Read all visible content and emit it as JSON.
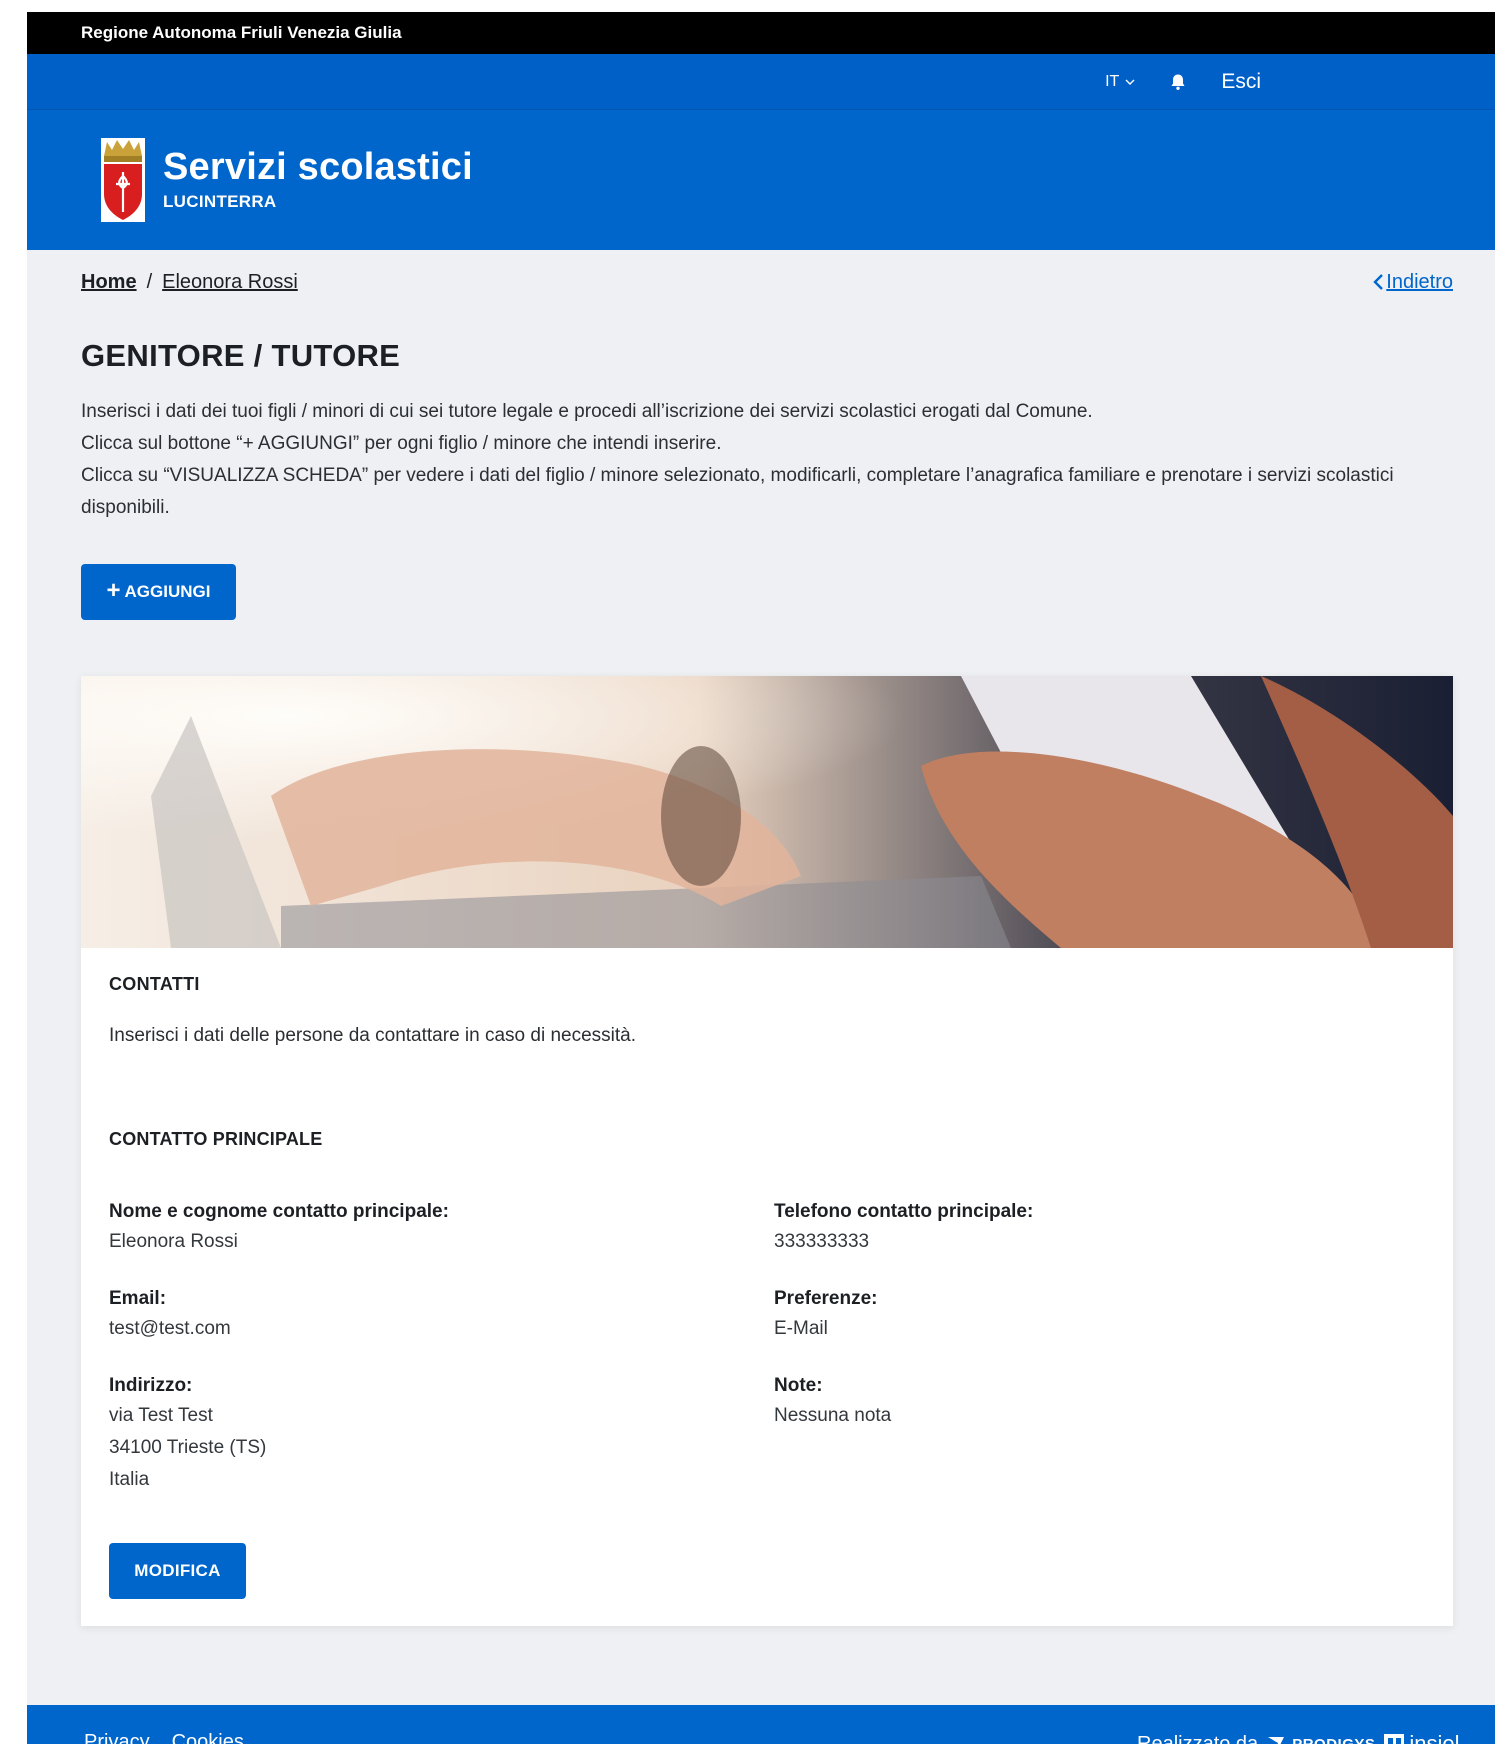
{
  "topbar": {
    "region": "Regione Autonoma Friuli Venezia Giulia"
  },
  "utility": {
    "language": "IT",
    "logout": "Esci"
  },
  "header": {
    "title": "Servizi scolastici",
    "subtitle": "LUCINTERRA"
  },
  "breadcrumb": {
    "home": "Home",
    "current": "Eleonora Rossi",
    "back": "Indietro"
  },
  "page": {
    "title": "GENITORE / TUTORE",
    "intro": [
      "Inserisci i dati dei tuoi figli / minori di cui sei tutore legale e procedi all’iscrizione dei servizi scolastici erogati dal Comune.",
      "Clicca sul bottone “+ AGGIUNGI” per ogni figlio / minore che intendi inserire.",
      "Clicca su “VISUALIZZA SCHEDA” per vedere i dati del figlio / minore selezionato, modificarli, completare l’anagrafica familiare e prenotare i servizi scolastici disponibili."
    ],
    "add_button": "AGGIUNGI"
  },
  "card": {
    "title": "CONTATTI",
    "description": "Inserisci i dati delle persone da contattare in caso di necessità.",
    "section_title": "CONTATTO PRINCIPALE",
    "fields": {
      "name_label": "Nome e cognome contatto principale:",
      "name_value": "Eleonora Rossi",
      "phone_label": "Telefono contatto principale:",
      "phone_value": "333333333",
      "email_label": "Email:",
      "email_value": "test@test.com",
      "pref_label": "Preferenze:",
      "pref_value": "E-Mail",
      "address_label": "Indirizzo:",
      "address_line1": "via Test Test",
      "address_line2": "34100 Trieste (TS)",
      "address_line3": "Italia",
      "note_label": "Note:",
      "note_value": "Nessuna nota"
    },
    "edit_button": "MODIFICA"
  },
  "footer": {
    "privacy": "Privacy",
    "cookies": "Cookies",
    "made_by": "Realizzato da",
    "prodigys": "PRODIGYS",
    "insiel": "insiel"
  },
  "colors": {
    "primary": "#0066cc",
    "topbar": "#000000",
    "background": "#eef0f3"
  }
}
